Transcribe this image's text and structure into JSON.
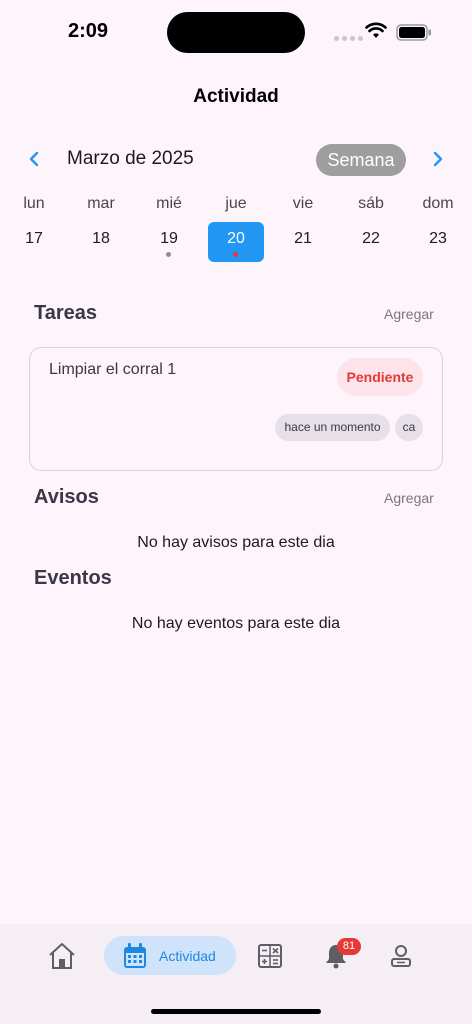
{
  "status_bar": {
    "time": "2:09"
  },
  "header": {
    "title": "Actividad"
  },
  "calendar": {
    "month_label": "Marzo de 2025",
    "view_mode": "Semana",
    "days": [
      {
        "dow": "lun",
        "num": "17"
      },
      {
        "dow": "mar",
        "num": "18"
      },
      {
        "dow": "mié",
        "num": "19"
      },
      {
        "dow": "jue",
        "num": "20"
      },
      {
        "dow": "vie",
        "num": "21"
      },
      {
        "dow": "sáb",
        "num": "22"
      },
      {
        "dow": "dom",
        "num": "23"
      }
    ],
    "selected_day": "20"
  },
  "tasks": {
    "heading": "Tareas",
    "add_label": "Agregar",
    "items": [
      {
        "title": "Limpiar el corral 1",
        "status": "Pendiente",
        "time": "hace un momento",
        "author": "ca"
      }
    ]
  },
  "notices": {
    "heading": "Avisos",
    "add_label": "Agregar",
    "empty": "No hay avisos para este dia"
  },
  "events": {
    "heading": "Eventos",
    "empty": "No hay eventos para este dia"
  },
  "bottom_nav": {
    "active_label": "Actividad",
    "notification_count": "81"
  },
  "colors": {
    "accent": "#2196f3",
    "danger": "#e53935",
    "background": "#fdf5fb"
  }
}
